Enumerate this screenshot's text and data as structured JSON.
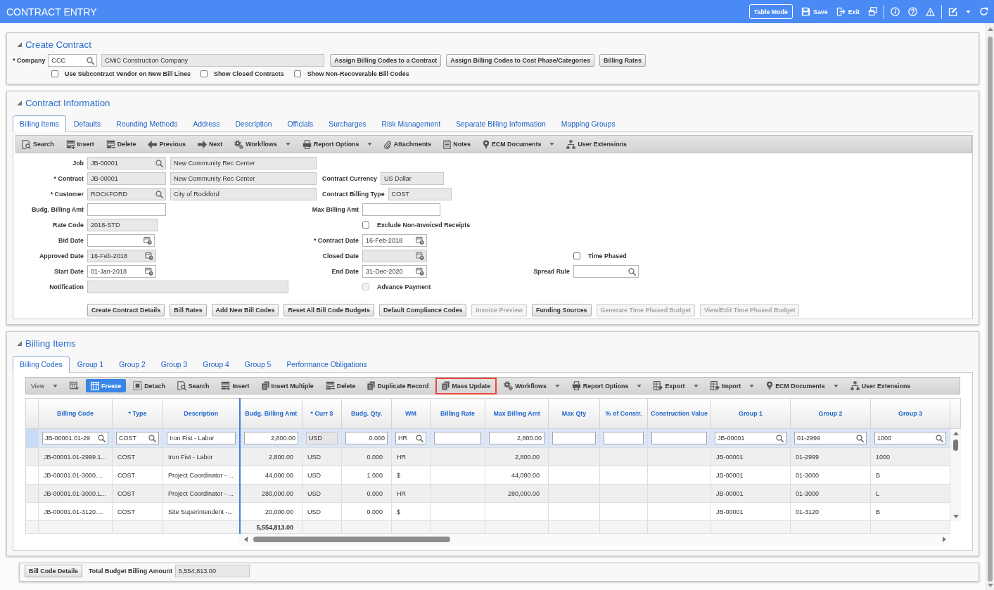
{
  "header": {
    "title": "CONTRACT ENTRY",
    "action_groups": [
      [
        {
          "kind": "tablemode",
          "label": "Table Mode",
          "dropdown": false
        },
        {
          "kind": "save",
          "label": "Save",
          "dropdown": false
        },
        {
          "kind": "exit",
          "label": "Exit",
          "dropdown": false
        },
        {
          "kind": "windows",
          "dropdown": false
        }
      ],
      [
        {
          "kind": "info",
          "dropdown": false
        },
        {
          "kind": "help",
          "dropdown": false
        },
        {
          "kind": "warning",
          "dropdown": false
        }
      ],
      [
        {
          "kind": "edit",
          "dropdown": true
        },
        {
          "kind": "refresh",
          "dropdown": false
        }
      ]
    ]
  },
  "create_contract": {
    "title": "Create Contract",
    "expanded": true,
    "fields": [
      {
        "label": "* Company",
        "kind": "lookup",
        "value": "CCC",
        "disabled": false
      },
      {
        "kind": "text",
        "value": "CMiC Construction Company",
        "disabled": true
      }
    ],
    "buttons": [
      {
        "label": "Assign Billing Codes to a Contract",
        "disabled": false
      },
      {
        "label": "Assign Billing Codes to Cost Phase/Categories",
        "disabled": false
      },
      {
        "label": "Billing Rates",
        "disabled": false
      }
    ],
    "options": [
      {
        "label": "Use Subcontract Vendor on New Bill Lines",
        "checked": false
      },
      {
        "label": "Show Closed Contracts",
        "checked": false
      },
      {
        "label": "Show Non-Recoverable Bill Codes",
        "checked": false
      }
    ]
  },
  "contract_information": {
    "title": "Contract Information",
    "expanded": true,
    "tabs": [
      {
        "label": "Billing Items",
        "selected": true
      },
      {
        "label": "Defaults",
        "selected": false
      },
      {
        "label": "Rounding Methods",
        "selected": false
      },
      {
        "label": "Address",
        "selected": false
      },
      {
        "label": "Description",
        "selected": false
      },
      {
        "label": "Officials",
        "selected": false
      },
      {
        "label": "Surcharges",
        "selected": false
      },
      {
        "label": "Risk Management",
        "selected": false
      },
      {
        "label": "Separate Billing Information",
        "selected": false
      },
      {
        "label": "Mapping Groups",
        "selected": false
      }
    ],
    "toolbar": [
      {
        "kind": "search",
        "label": "Search",
        "dropdown": false
      },
      {
        "kind": "insert",
        "label": "Insert",
        "dropdown": false
      },
      {
        "kind": "delete",
        "label": "Delete",
        "dropdown": false
      },
      {
        "kind": "previous",
        "label": "Previous",
        "dropdown": false
      },
      {
        "kind": "next",
        "label": "Next",
        "dropdown": false
      },
      {
        "kind": "workflows",
        "label": "Workflows",
        "dropdown": true
      },
      {
        "kind": "reports",
        "label": "Report Options",
        "dropdown": true
      },
      {
        "kind": "attachments",
        "label": "Attachments",
        "dropdown": false
      },
      {
        "kind": "notes",
        "label": "Notes",
        "dropdown": false
      },
      {
        "kind": "documents",
        "label": "ECM Documents",
        "dropdown": true
      },
      {
        "kind": "extensions",
        "label": "User Extensions",
        "dropdown": false
      }
    ],
    "form": [
      [
        {
          "label": "Job",
          "kind": "lookup",
          "value": "JB-00001",
          "disabled": true
        },
        {
          "kind": "text",
          "value": "New Community Rec Center",
          "disabled": true
        }
      ],
      [
        {
          "label": "* Contract",
          "kind": "text",
          "value": "JB-00001",
          "disabled": true
        },
        {
          "kind": "text",
          "value": "New Community Rec Center",
          "disabled": true
        },
        {
          "label": "Contract Currency",
          "kind": "text",
          "value": "US Dollar",
          "disabled": true
        }
      ],
      [
        {
          "label": "* Customer",
          "kind": "lookup",
          "value": "ROCKFORD",
          "disabled": true
        },
        {
          "kind": "text",
          "value": "City of Rockford",
          "disabled": true
        },
        {
          "label": "Contract Billing Type",
          "kind": "text",
          "value": "COST",
          "disabled": true
        }
      ],
      [
        {
          "label": "Budg. Billing Amt",
          "kind": "text",
          "disabled": false
        },
        {
          "label": "Max Billing Amt",
          "kind": "text",
          "disabled": false
        }
      ],
      [
        {
          "label": "Rate Code",
          "kind": "text",
          "value": "2018-STD",
          "disabled": true
        },
        {
          "label": "Exclude Non-Invoiced Receipts",
          "kind": "checkbox",
          "checked": false,
          "disabled": false
        }
      ],
      [
        {
          "label": "Bid Date",
          "kind": "date",
          "disabled": false
        },
        {
          "label": "* Contract Date",
          "kind": "date",
          "value": "16-Feb-2018",
          "disabled": false
        }
      ],
      [
        {
          "label": "Approved Date",
          "kind": "date",
          "value": "16-Feb-2018",
          "disabled": true
        },
        {
          "label": "Closed Date",
          "kind": "date",
          "disabled": true
        },
        {
          "label": "Time Phased",
          "kind": "checkbox",
          "checked": false,
          "disabled": false
        }
      ],
      [
        {
          "label": "Start Date",
          "kind": "date",
          "value": "01-Jan-2018",
          "disabled": false
        },
        {
          "label": "End Date",
          "kind": "date",
          "value": "31-Dec-2020",
          "disabled": false
        },
        {
          "label": "Spread Rule",
          "kind": "lookup",
          "disabled": false
        }
      ],
      [
        {
          "label": "Notification",
          "kind": "text",
          "disabled": true
        },
        {
          "label": "Advance Payment",
          "kind": "checkbox",
          "checked": false,
          "disabled": true
        }
      ]
    ],
    "buttons": [
      {
        "label": "Create Contract Details",
        "disabled": false
      },
      {
        "label": "Bill Rates",
        "disabled": false
      },
      {
        "label": "Add New Bill Codes",
        "disabled": false
      },
      {
        "label": "Reset All Bill Code Budgets",
        "disabled": false
      },
      {
        "label": "Default Compliance Codes",
        "disabled": false
      },
      {
        "label": "Invoice Preview",
        "disabled": true
      },
      {
        "label": "Funding Sources",
        "disabled": false
      },
      {
        "label": "Generate Time Phased Budget",
        "disabled": true
      },
      {
        "label": "View/Edit Time Phased Budget",
        "disabled": true
      }
    ]
  },
  "billing_items": {
    "title": "Billing Items",
    "expanded": true,
    "tabs": [
      {
        "label": "Billing Codes",
        "selected": true
      },
      {
        "label": "Group 1",
        "selected": false
      },
      {
        "label": "Group 2",
        "selected": false
      },
      {
        "label": "Group 3",
        "selected": false
      },
      {
        "label": "Group 4",
        "selected": false
      },
      {
        "label": "Group 5",
        "selected": false
      },
      {
        "label": "Performance Obligations",
        "selected": false
      }
    ],
    "toolbar": [
      {
        "kind": "view",
        "label": "View",
        "dropdown": true,
        "on": false,
        "highlighted": false
      },
      {
        "kind": "columns",
        "dropdown": false,
        "on": false,
        "highlighted": false
      },
      {
        "kind": "freeze",
        "label": "Freeze",
        "dropdown": false,
        "on": true,
        "highlighted": false
      },
      {
        "kind": "detach",
        "label": "Detach",
        "dropdown": false,
        "on": false,
        "highlighted": false
      },
      {
        "kind": "search",
        "label": "Search",
        "dropdown": false,
        "on": false,
        "highlighted": false
      },
      {
        "kind": "insert",
        "label": "Insert",
        "dropdown": false,
        "on": false,
        "highlighted": false
      },
      {
        "kind": "multiinsert",
        "label": "Insert Multiple",
        "dropdown": false,
        "on": false,
        "highlighted": false
      },
      {
        "kind": "delete",
        "label": "Delete",
        "dropdown": false,
        "on": false,
        "highlighted": false
      },
      {
        "kind": "duplicate",
        "label": "Duplicate Record",
        "dropdown": false,
        "on": false,
        "highlighted": false
      },
      {
        "kind": "massupdate",
        "label": "Mass Update",
        "dropdown": false,
        "on": false,
        "highlighted": true
      },
      {
        "kind": "workflows",
        "label": "Workflows",
        "dropdown": true,
        "on": false,
        "highlighted": false
      },
      {
        "kind": "reports",
        "label": "Report Options",
        "dropdown": true,
        "on": false,
        "highlighted": false
      },
      {
        "kind": "export",
        "label": "Export",
        "dropdown": true,
        "on": false,
        "highlighted": false
      },
      {
        "kind": "import",
        "label": "Import",
        "dropdown": true,
        "on": false,
        "highlighted": false
      },
      {
        "kind": "documents",
        "label": "ECM Documents",
        "dropdown": true,
        "on": false,
        "highlighted": false
      },
      {
        "kind": "extensions",
        "label": "User Extensions",
        "dropdown": false,
        "on": false,
        "highlighted": false
      }
    ],
    "grid": {
      "columns": [
        {
          "label": "Billing Code",
          "kind": "text",
          "frozen": true
        },
        {
          "label": "* Type",
          "kind": "text",
          "frozen": true
        },
        {
          "label": "Description",
          "kind": "text",
          "frozen": true
        },
        {
          "label": "Budg. Billing Amt",
          "kind": "number",
          "frozen": false,
          "total": "5,554,813.00"
        },
        {
          "label": "* Curr $",
          "kind": "text",
          "frozen": false
        },
        {
          "label": "Budg. Qty.",
          "kind": "number",
          "frozen": false
        },
        {
          "label": "WM",
          "kind": "text",
          "frozen": false
        },
        {
          "label": "Billing Rate",
          "kind": "number",
          "frozen": false
        },
        {
          "label": "Max Billing Amt",
          "kind": "number",
          "frozen": false
        },
        {
          "label": "Max Qty",
          "kind": "number",
          "frozen": false
        },
        {
          "label": "% of Constr.",
          "kind": "number",
          "frozen": false
        },
        {
          "label": "Construction Value",
          "kind": "number",
          "frozen": false
        },
        {
          "label": "Group 1",
          "kind": "text",
          "frozen": false
        },
        {
          "label": "Group 2",
          "kind": "text",
          "frozen": false
        },
        {
          "label": "Group 3",
          "kind": "text",
          "frozen": false
        }
      ],
      "editor_row": [
        {
          "value": "JB-00001.01-29",
          "lookup": true,
          "disabled": false
        },
        {
          "value": "COST",
          "lookup": true,
          "disabled": false
        },
        {
          "value": "Iron Fist - Labor",
          "lookup": false,
          "disabled": false
        },
        {
          "value": "2,800.00",
          "lookup": false,
          "disabled": false
        },
        {
          "value": "USD",
          "lookup": false,
          "disabled": true
        },
        {
          "value": "0.000",
          "lookup": false,
          "disabled": false
        },
        {
          "value": "HR",
          "lookup": true,
          "disabled": false
        },
        {
          "lookup": false,
          "disabled": false
        },
        {
          "value": "2,800.00",
          "lookup": false,
          "disabled": false
        },
        {
          "lookup": false,
          "disabled": false
        },
        {
          "lookup": false,
          "disabled": false
        },
        {
          "lookup": false,
          "disabled": false
        },
        {
          "value": "JB-00001",
          "lookup": true,
          "disabled": false
        },
        {
          "value": "01-2999",
          "lookup": true,
          "disabled": false
        },
        {
          "value": "1000",
          "lookup": true,
          "disabled": false
        }
      ],
      "rows": [
        [
          "JB-00001.01-2999.1...",
          "COST",
          "Iron Fist - Labor",
          "2,800.00",
          "USD",
          "0.000",
          "HR",
          null,
          "2,800.00",
          null,
          null,
          null,
          "JB-00001",
          "01-2999",
          "1000"
        ],
        [
          "JB-00001.01-3000....",
          "COST",
          "Project Coordinator - ...",
          "44,000.00",
          "USD",
          "1.000",
          "$",
          null,
          "44,000.00",
          null,
          null,
          null,
          "JB-00001",
          "01-3000",
          "B"
        ],
        [
          "JB-00001.01-3000.L...",
          "COST",
          "Project Coordinator - ...",
          "280,000.00",
          "USD",
          "0.000",
          "HR",
          null,
          "280,000.00",
          null,
          null,
          null,
          "JB-00001",
          "01-3000",
          "L"
        ],
        [
          "JB-00001.01-3120....",
          "COST",
          "Site Superintendent -...",
          "20,000.00",
          "USD",
          "0.000",
          "$",
          null,
          null,
          null,
          null,
          null,
          "JB-00001",
          "01-3120",
          "B"
        ]
      ]
    }
  },
  "footer": {
    "buttons": [
      {
        "label": "Bill Code Details",
        "disabled": false
      }
    ],
    "total": {
      "label": "Total Budget Billing Amount",
      "kind": "text",
      "value": "5,554,813.00",
      "disabled": true
    }
  }
}
